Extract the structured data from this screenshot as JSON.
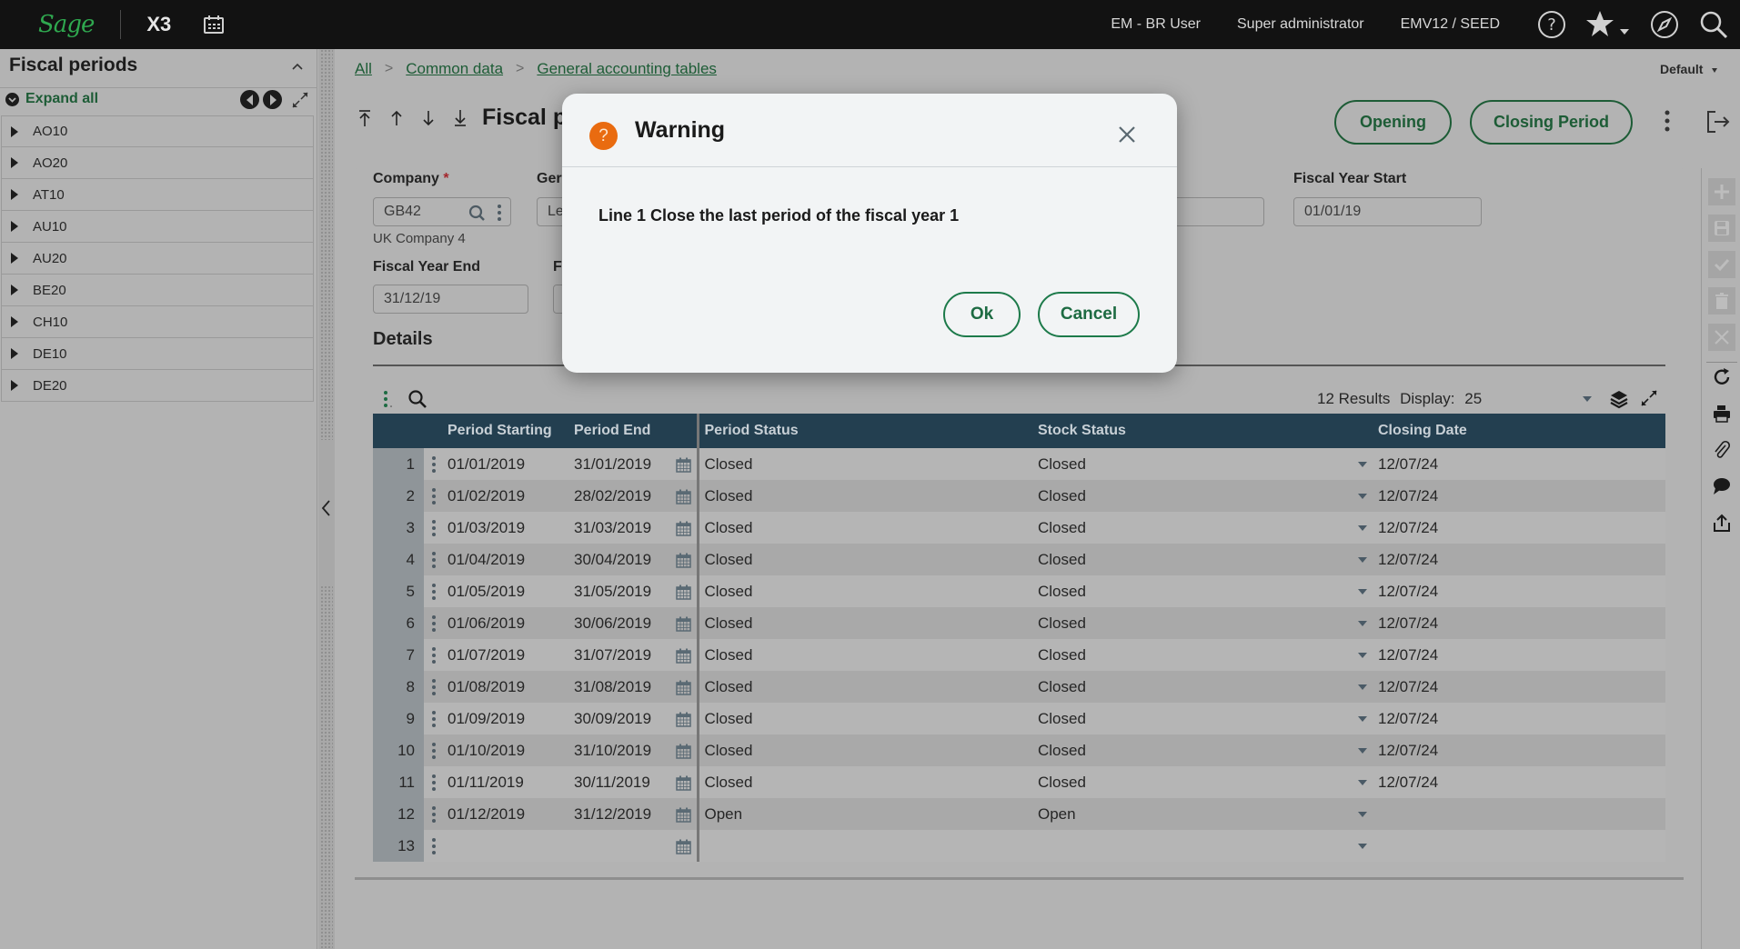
{
  "topbar": {
    "logo": "Sage",
    "product": "X3",
    "user": "EM - BR User",
    "role": "Super administrator",
    "endpoint": "EMV12 / SEED",
    "icons": [
      "calendar-icon",
      "help-icon",
      "star-icon",
      "compass-icon",
      "search-icon"
    ]
  },
  "left_panel": {
    "title": "Fiscal periods",
    "expand_all": "Expand all",
    "items": [
      "AO10",
      "AO20",
      "AT10",
      "AU10",
      "AU20",
      "BE20",
      "CH10",
      "DE10",
      "DE20"
    ]
  },
  "breadcrumb": [
    "All",
    "Common data",
    "General accounting tables"
  ],
  "view_selector": "Default",
  "page": {
    "title": "Fiscal periods",
    "buttons": {
      "opening": "Opening",
      "closing_period": "Closing Period"
    }
  },
  "form": {
    "company_label": "Company",
    "company_value": "GB42",
    "company_name": "UK Company 4",
    "general_label": "Ger",
    "general_value": "Le",
    "fiscal_year_end_label": "Fiscal Year End",
    "fiscal_year_end_value": "31/12/19",
    "f_label": "F",
    "fiscal_year_start_label": "Fiscal Year Start",
    "fiscal_year_start_value": "01/01/19",
    "details_title": "Details"
  },
  "grid": {
    "results": "12 Results",
    "display_label": "Display:",
    "display_value": "25",
    "columns": [
      "Period Starting",
      "Period End",
      "Period Status",
      "Stock Status",
      "Closing Date"
    ],
    "rows": [
      {
        "n": "1",
        "start": "01/01/2019",
        "end": "31/01/2019",
        "period_status": "Closed",
        "stock_status": "Closed",
        "closing": "12/07/24"
      },
      {
        "n": "2",
        "start": "01/02/2019",
        "end": "28/02/2019",
        "period_status": "Closed",
        "stock_status": "Closed",
        "closing": "12/07/24"
      },
      {
        "n": "3",
        "start": "01/03/2019",
        "end": "31/03/2019",
        "period_status": "Closed",
        "stock_status": "Closed",
        "closing": "12/07/24"
      },
      {
        "n": "4",
        "start": "01/04/2019",
        "end": "30/04/2019",
        "period_status": "Closed",
        "stock_status": "Closed",
        "closing": "12/07/24"
      },
      {
        "n": "5",
        "start": "01/05/2019",
        "end": "31/05/2019",
        "period_status": "Closed",
        "stock_status": "Closed",
        "closing": "12/07/24"
      },
      {
        "n": "6",
        "start": "01/06/2019",
        "end": "30/06/2019",
        "period_status": "Closed",
        "stock_status": "Closed",
        "closing": "12/07/24"
      },
      {
        "n": "7",
        "start": "01/07/2019",
        "end": "31/07/2019",
        "period_status": "Closed",
        "stock_status": "Closed",
        "closing": "12/07/24"
      },
      {
        "n": "8",
        "start": "01/08/2019",
        "end": "31/08/2019",
        "period_status": "Closed",
        "stock_status": "Closed",
        "closing": "12/07/24"
      },
      {
        "n": "9",
        "start": "01/09/2019",
        "end": "30/09/2019",
        "period_status": "Closed",
        "stock_status": "Closed",
        "closing": "12/07/24"
      },
      {
        "n": "10",
        "start": "01/10/2019",
        "end": "31/10/2019",
        "period_status": "Closed",
        "stock_status": "Closed",
        "closing": "12/07/24"
      },
      {
        "n": "11",
        "start": "01/11/2019",
        "end": "30/11/2019",
        "period_status": "Closed",
        "stock_status": "Closed",
        "closing": "12/07/24"
      },
      {
        "n": "12",
        "start": "01/12/2019",
        "end": "31/12/2019",
        "period_status": "Open",
        "stock_status": "Open",
        "closing": ""
      },
      {
        "n": "13",
        "start": "",
        "end": "",
        "period_status": "",
        "stock_status": "",
        "closing": ""
      }
    ]
  },
  "right_toolbar": [
    "plus-icon",
    "save-icon",
    "check-icon",
    "trash-icon",
    "close-icon",
    "refresh-icon",
    "print-icon",
    "attachment-icon",
    "comment-icon",
    "share-icon"
  ],
  "dialog": {
    "title": "Warning",
    "message": "Line 1 Close the last period of the fiscal year 1",
    "ok": "Ok",
    "cancel": "Cancel"
  },
  "colors": {
    "brand_green": "#2fa84f",
    "action_green": "#1d5c36",
    "grid_header": "#233f50",
    "warning_orange": "#e96b10"
  }
}
